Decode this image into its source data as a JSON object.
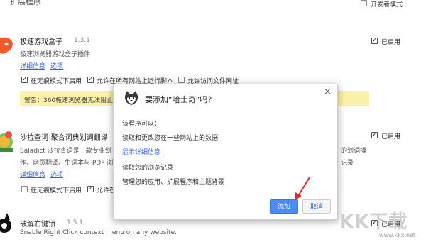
{
  "header": {
    "title_fragment": "扩展程序",
    "developer_mode_label": "开发者模式",
    "developer_mode_checked": false
  },
  "extensions": [
    {
      "name": "极速游戏盒子",
      "version": "1.3.1",
      "description": "极速浏览器游戏盒子插件",
      "details_link": "详细信息",
      "options_link": "选项",
      "enabled_label": "已启用",
      "enabled": true,
      "incognito_label": "在无痕模式下启用",
      "incognito_checked": true,
      "all_sites_label": "允许在所有网站上运行脚本",
      "all_sites_checked": true,
      "file_urls_label": "允许访问文件网址",
      "file_urls_checked": false,
      "warning": "警告：360极速浏览器无法阻止"
    },
    {
      "name": "沙拉查词-聚合词典划词翻译",
      "description_line1": "Saladict 沙拉查词是一款专业划",
      "description_line1_right": "的划词摸",
      "description_line2": "作、网页翻译、生词本与 PDF 浏",
      "description_line2_right": "记录",
      "details_link": "详细信息",
      "options_link": "选项",
      "enabled_label": "已启用",
      "enabled": true,
      "incognito_label": "在无痕模式下启用",
      "incognito_checked": false,
      "all_sites_label_partial": "允许在",
      "all_sites_checked": true
    },
    {
      "name": "破解右键锁",
      "version": "1.5.1",
      "description": "Enable Right Click context menu on any website.",
      "enabled_label": "已启用",
      "enabled": true
    }
  ],
  "dialog": {
    "title": "要添加“哈士奇”吗？",
    "permissions_heading": "该程序可以：",
    "permission_1": "读取和更改您在一些网站上的数据",
    "show_details_link": "显示详细信息",
    "permission_2": "读取您的浏览记录",
    "permission_3": "管理您的应用、扩展程序和主题背景",
    "add_button": "添加",
    "cancel_button": "取消",
    "close_glyph": "×"
  },
  "watermark": {
    "logo_text": "KK下载",
    "url": "www.kkx.net"
  },
  "colors": {
    "warning_bg": "#fbf1a9",
    "primary_button": "#4a8df8",
    "link": "#3367d6",
    "arrow": "#e0282a"
  }
}
